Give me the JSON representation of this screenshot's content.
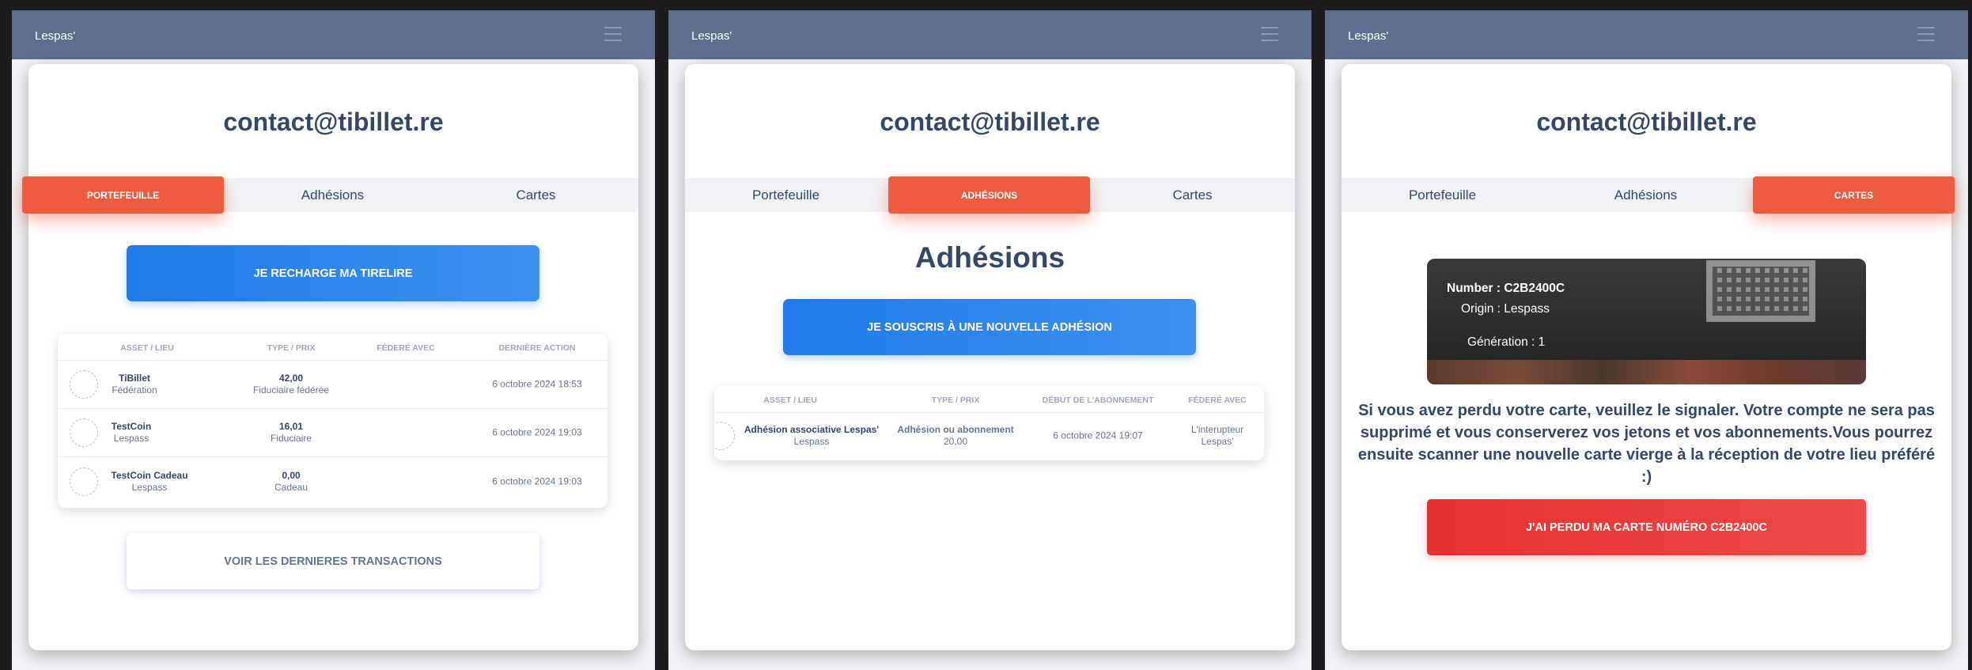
{
  "brand": "Lespas'",
  "email": "contact@tibillet.re",
  "tabs": {
    "wallet": "Portefeuille",
    "memberships": "Adhésions",
    "cards": "Cartes"
  },
  "wallet": {
    "recharge_button": "Je recharge ma tirelire",
    "headers": [
      "Asset / lieu",
      "Type / prix",
      "Féderé avec",
      "Dernière action"
    ],
    "rows": [
      {
        "name": "TiBillet",
        "place": "Fédération",
        "amount": "42,00",
        "type": "Fiduciaire fédérée",
        "federated": "",
        "date": "6 octobre 2024 18:53"
      },
      {
        "name": "TestCoin",
        "place": "Lespass",
        "amount": "16,01",
        "type": "Fiduciaire",
        "federated": "",
        "date": "6 octobre 2024 19:03"
      },
      {
        "name": "TestCoin Cadeau",
        "place": "Lespass",
        "amount": "0,00",
        "type": "Cadeau",
        "federated": "",
        "date": "6 octobre 2024 19:03"
      }
    ],
    "transactions_button": "Voir les dernieres transactions"
  },
  "memberships": {
    "title": "Adhésions",
    "subscribe_button": "Je souscris à une nouvelle adhésion",
    "headers": [
      "Asset / lieu",
      "Type / prix",
      "Début de l'abonnement",
      "Féderé avec"
    ],
    "rows": [
      {
        "name": "Adhésion associative Lespas'",
        "place": "Lespass",
        "type": "Adhésion ou abonnement",
        "price": "20,00",
        "start": "6 octobre 2024 19:07",
        "federated_1": "L'interupteur",
        "federated_2": "Lespas'"
      }
    ]
  },
  "cards": {
    "number": "Number : C2B2400C",
    "origin": "Origin : Lespass",
    "generation": "Génération : 1",
    "lost_message": "Si vous avez perdu votre carte, veuillez le signaler. Votre compte ne sera pas supprimé et vous conserverez vos jetons et vos abonnements.Vous pourrez ensuite scanner une nouvelle carte vierge à la réception de votre lieu préféré :)",
    "lost_button": "J'ai perdu ma carte numéro C2B2400C"
  },
  "colors": {
    "navbar": "#5e6e8c",
    "accent": "#ef5b3f",
    "primary": "#1f7be8",
    "danger": "#e63131",
    "text": "#344767"
  },
  "icons": {
    "menu": "hamburger-menu-icon",
    "avatar": "asset-avatar-icon"
  }
}
